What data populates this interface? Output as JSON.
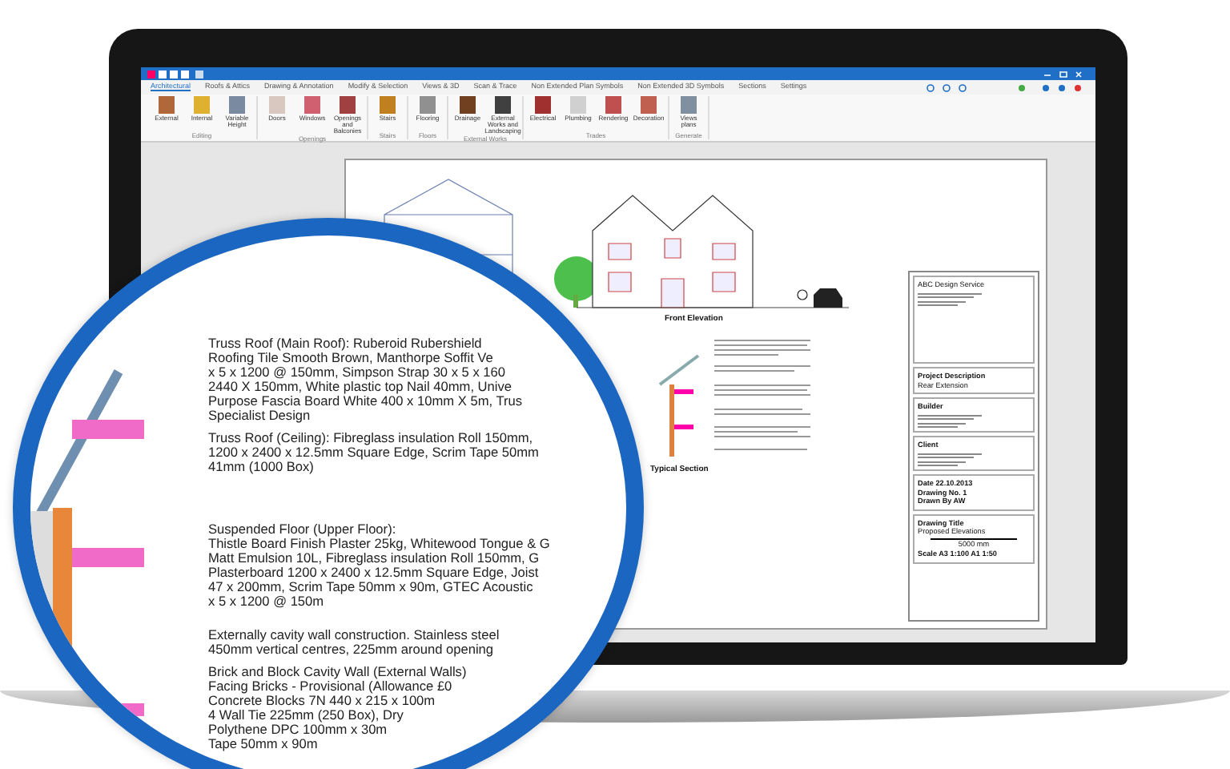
{
  "ribbon_tabs": [
    {
      "label": "Architectural",
      "selected": true
    },
    {
      "label": "Roofs & Attics",
      "selected": false
    },
    {
      "label": "Drawing & Annotation",
      "selected": false
    },
    {
      "label": "Modify & Selection",
      "selected": false
    },
    {
      "label": "Views & 3D",
      "selected": false
    },
    {
      "label": "Scan & Trace",
      "selected": false
    },
    {
      "label": "Non Extended Plan Symbols",
      "selected": false
    },
    {
      "label": "Non Extended 3D Symbols",
      "selected": false
    },
    {
      "label": "Sections",
      "selected": false
    },
    {
      "label": "Settings",
      "selected": false
    }
  ],
  "ribbon_groups": [
    {
      "label": "Editing",
      "buttons": [
        {
          "label": "External",
          "color": "#b0683a"
        },
        {
          "label": "Internal",
          "color": "#e0b030"
        },
        {
          "label": "Variable Height",
          "color": "#7a8aa0"
        }
      ]
    },
    {
      "label": "Openings",
      "buttons": [
        {
          "label": "Doors",
          "color": "#d8c8c0"
        },
        {
          "label": "Windows",
          "color": "#d06070"
        },
        {
          "label": "Openings and Balconies",
          "color": "#a04040"
        }
      ]
    },
    {
      "label": "Stairs",
      "buttons": [
        {
          "label": "Stairs",
          "color": "#c08020"
        }
      ]
    },
    {
      "label": "Floors",
      "buttons": [
        {
          "label": "Flooring",
          "color": "#909090"
        }
      ]
    },
    {
      "label": "External Works",
      "buttons": [
        {
          "label": "Drainage",
          "color": "#704020"
        },
        {
          "label": "External Works and Landscaping",
          "color": "#404040"
        }
      ]
    },
    {
      "label": "Trades",
      "buttons": [
        {
          "label": "Electrical",
          "color": "#a03030"
        },
        {
          "label": "Plumbing",
          "color": "#d0d0d0"
        },
        {
          "label": "Rendering",
          "color": "#c05050"
        },
        {
          "label": "Decoration",
          "color": "#c06050"
        }
      ]
    },
    {
      "label": "Generate",
      "buttons": [
        {
          "label": "Views plans",
          "color": "#8090a0"
        }
      ]
    }
  ],
  "drawing": {
    "elevation_label": "Front Elevation",
    "section_label": "Typical Section",
    "title_block": {
      "company": "ABC Design Service",
      "fields": [
        {
          "heading": "Project Description",
          "value": "Rear Extension"
        },
        {
          "heading": "Builder"
        },
        {
          "heading": "Client"
        }
      ],
      "details": [
        "Date   22.10.2013",
        "Drawing No.   1",
        "Drawn By   AW"
      ],
      "drawing_title": {
        "heading": "Drawing Title",
        "value": "Proposed Elevations"
      },
      "scale_bar": "5000 mm",
      "scale": "Scale  A3 1:100   A1 1:50"
    }
  },
  "magnifier": {
    "paragraphs": [
      [
        "Truss Roof (Main Roof):  Ruberoid Rubershield",
        "Roofing Tile Smooth Brown, Manthorpe Soffit Ve",
        "x 5 x 1200 @ 150mm, Simpson Strap 30 x 5 x 160",
        "2440 X 150mm, White plastic top Nail 40mm, Unive",
        "Purpose Fascia Board White 400 x 10mm X 5m, Trus",
        "Specialist Design"
      ],
      [
        "Truss Roof (Ceiling):  Fibreglass insulation Roll 150mm,",
        "1200 x 2400 x 12.5mm Square Edge, Scrim Tape 50mm",
        "41mm (1000 Box)"
      ],
      [
        "Suspended Floor (Upper Floor):",
        "Thistle Board Finish Plaster 25kg, Whitewood Tongue & G",
        "Matt Emulsion 10L, Fibreglass insulation Roll 150mm, G",
        "Plasterboard 1200 x 2400 x 12.5mm Square Edge, Joist",
        "47 x 200mm, Scrim Tape 50mm x 90m, GTEC Acoustic",
        "x 5 x 1200 @ 150m"
      ],
      [
        "Externally cavity wall construction. Stainless steel",
        "450mm vertical centres, 225mm around opening"
      ],
      [
        "Brick and Block Cavity Wall (External Walls)",
        "Facing Bricks - Provisional (Allowance £0",
        "Concrete Blocks 7N 440 x 215 x 100m",
        "4 Wall Tie 225mm (250 Box), Dry",
        "Polythene DPC 100mm x 30m",
        "Tape 50mm x 90m"
      ]
    ]
  }
}
